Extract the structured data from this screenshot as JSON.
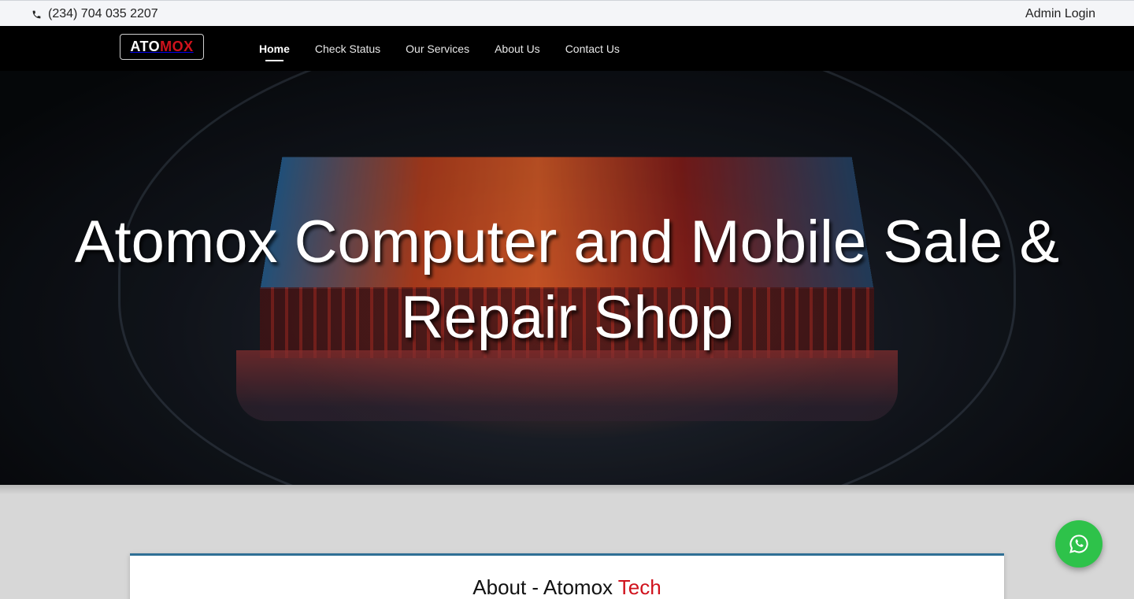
{
  "topbar": {
    "phone": "(234) 704 035 2207",
    "admin_login": "Admin Login"
  },
  "brand": {
    "part1": "ATO",
    "part2": "MOX",
    "accent_color": "#d0121c"
  },
  "nav": {
    "items": [
      {
        "label": "Home",
        "active": true
      },
      {
        "label": "Check Status",
        "active": false
      },
      {
        "label": "Our Services",
        "active": false
      },
      {
        "label": "About Us",
        "active": false
      },
      {
        "label": "Contact Us",
        "active": false
      }
    ]
  },
  "hero": {
    "title": "Atomox Computer and Mobile Sale & Repair Shop"
  },
  "about": {
    "heading_main": "About - Atomox",
    "heading_accent": "Tech"
  },
  "widgets": {
    "whatsapp_icon": "whatsapp-icon",
    "whatsapp_color": "#2ec24a"
  }
}
